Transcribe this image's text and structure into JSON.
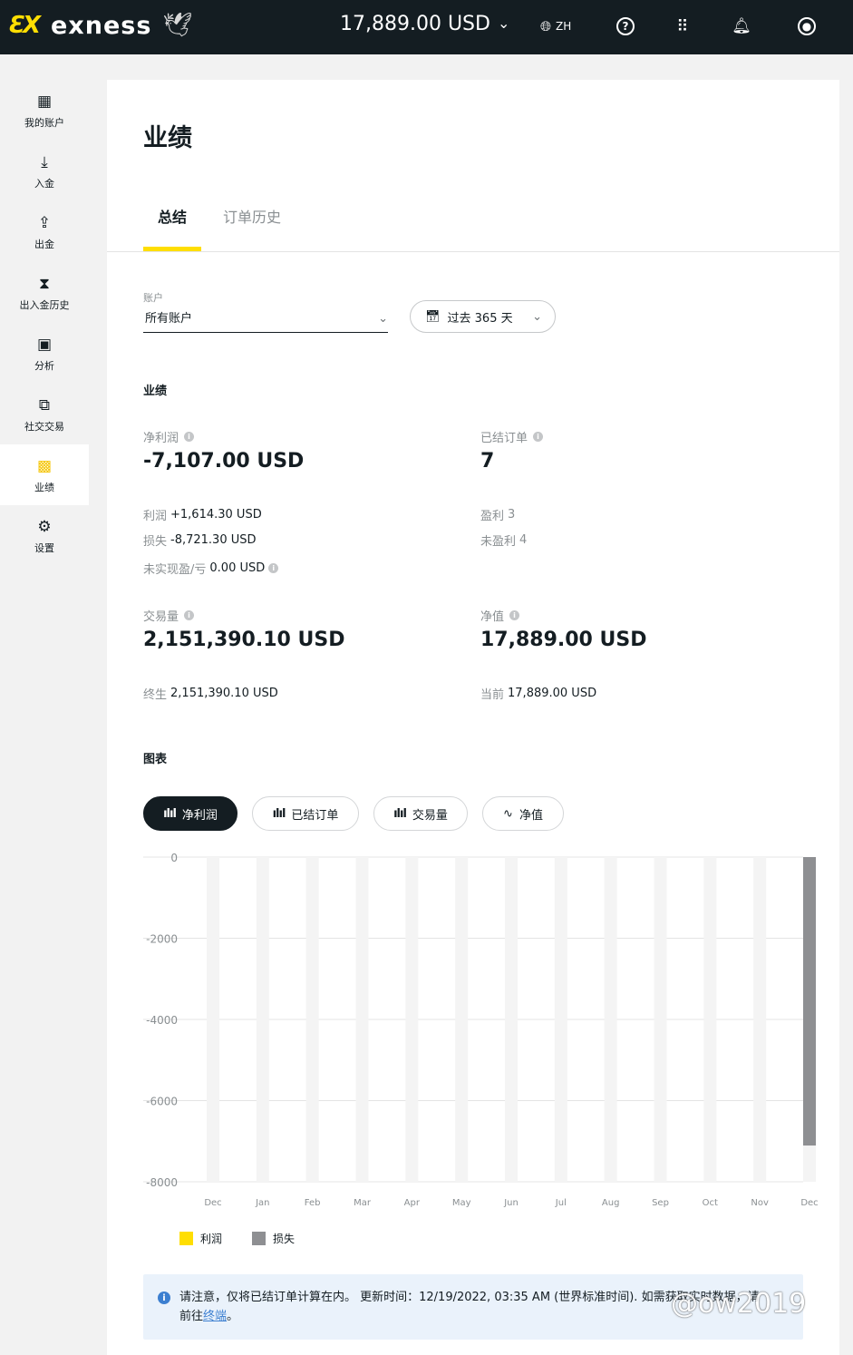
{
  "header": {
    "logo_mark": "ƐX",
    "logo_text": "exness",
    "balance": "17,889.00 USD",
    "language": "ZH"
  },
  "sidebar": {
    "items": [
      {
        "label": "我的账户",
        "icon": "grid-icon"
      },
      {
        "label": "入金",
        "icon": "download-icon"
      },
      {
        "label": "出金",
        "icon": "share-out-icon"
      },
      {
        "label": "出入金历史",
        "icon": "hourglass-icon"
      },
      {
        "label": "分析",
        "icon": "presentation-icon"
      },
      {
        "label": "社交交易",
        "icon": "copy-icon"
      },
      {
        "label": "业绩",
        "icon": "performance-icon"
      },
      {
        "label": "设置",
        "icon": "gear-icon"
      }
    ],
    "active_index": 6
  },
  "page": {
    "title": "业绩",
    "tabs": [
      "总结",
      "订单历史"
    ],
    "account_label": "账户",
    "account_value": "所有账户",
    "date_range": "过去 365 天",
    "section_performance": "业绩",
    "section_chart": "图表"
  },
  "stats": {
    "net_profit": {
      "label": "净利润",
      "value": "-7,107.00 USD"
    },
    "profit": {
      "label": "利润",
      "value": "+1,614.30 USD"
    },
    "loss": {
      "label": "损失",
      "value": "-8,721.30 USD"
    },
    "unrealized": {
      "label": "未实现盈/亏",
      "value": "0.00 USD"
    },
    "closed_orders": {
      "label": "已结订单",
      "value": "7"
    },
    "profitable": {
      "label": "盈利",
      "value": "3"
    },
    "unprofitable": {
      "label": "未盈利",
      "value": "4"
    },
    "volume": {
      "label": "交易量",
      "value": "2,151,390.10 USD"
    },
    "lifetime": {
      "label": "终生",
      "value": "2,151,390.10 USD"
    },
    "equity": {
      "label": "净值",
      "value": "17,889.00 USD"
    },
    "current": {
      "label": "当前",
      "value": "17,889.00 USD"
    }
  },
  "chart_tabs": [
    "净利润",
    "已结订单",
    "交易量",
    "净值"
  ],
  "chart_data": {
    "type": "bar",
    "categories": [
      "Dec",
      "Jan",
      "Feb",
      "Mar",
      "Apr",
      "May",
      "Jun",
      "Jul",
      "Aug",
      "Sep",
      "Oct",
      "Nov",
      "Dec"
    ],
    "series": [
      {
        "name": "利润",
        "values": [
          0,
          0,
          0,
          0,
          0,
          0,
          0,
          0,
          0,
          0,
          0,
          0,
          0
        ],
        "color": "#ffde02"
      },
      {
        "name": "损失",
        "values": [
          0,
          0,
          0,
          0,
          0,
          0,
          0,
          0,
          0,
          0,
          0,
          0,
          -7107
        ],
        "color": "#8e8f92"
      }
    ],
    "yticks": [
      "0",
      "-2000",
      "-4000",
      "-6000",
      "-8000"
    ],
    "ylim": [
      -8000,
      0
    ],
    "grid": true,
    "legend": "bottom-left"
  },
  "notice": {
    "text": "请注意，仅将已结订单计算在内。 更新时间：12/19/2022, 03:35 AM (世界标准时间). 如需获取实时数据，请",
    "link_prefix": "前往",
    "link": "终端",
    "suffix": "。"
  },
  "watermark": "@ow2019"
}
